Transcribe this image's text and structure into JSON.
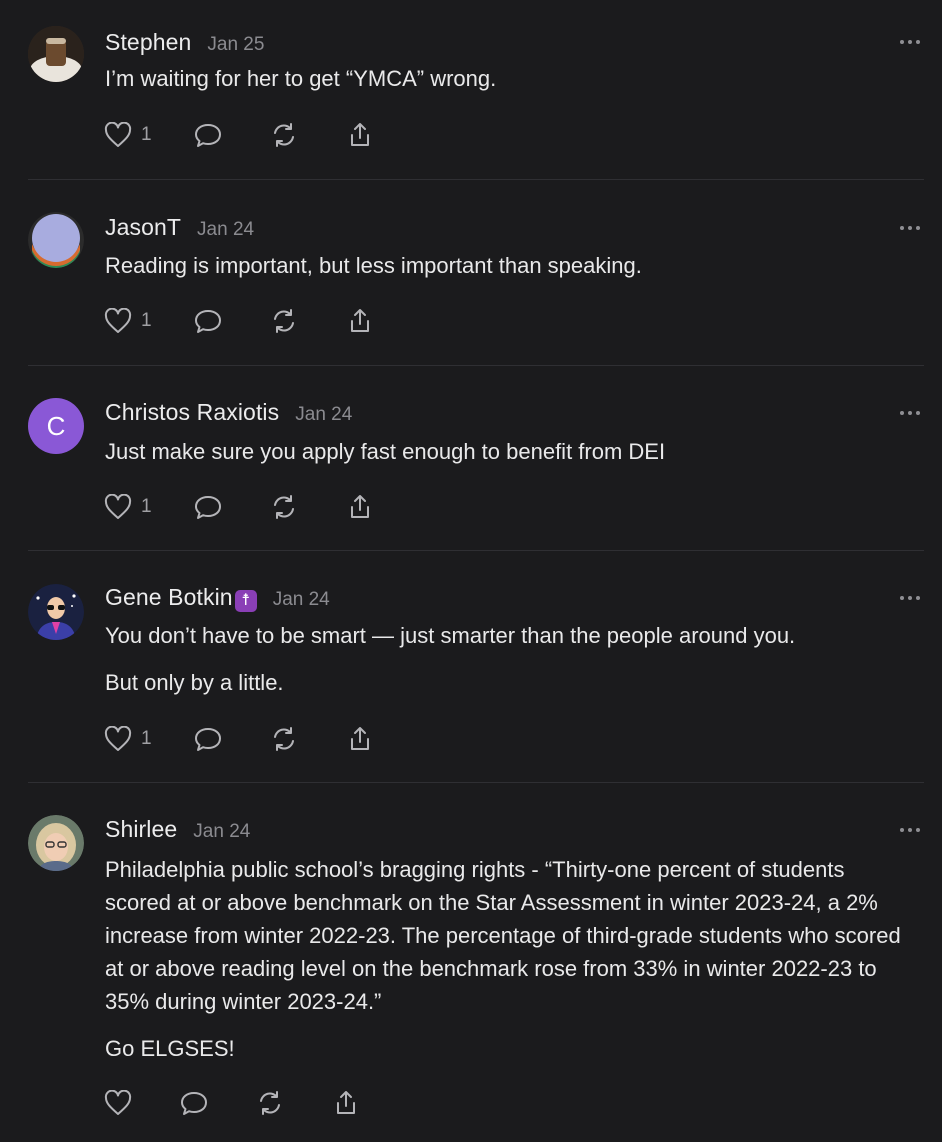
{
  "comments": [
    {
      "name": "Stephen",
      "date": "Jan 25",
      "paragraphs": [
        "I’m waiting for her to get “YMCA” wrong."
      ],
      "likes": "1"
    },
    {
      "name": "JasonT",
      "date": "Jan 24",
      "paragraphs": [
        "Reading is important, but less important than speaking."
      ],
      "likes": "1"
    },
    {
      "name": "Christos Raxiotis",
      "date": "Jan 24",
      "avatar_letter": "C",
      "avatar_color": "#8a58d6",
      "paragraphs": [
        "Just make sure you apply fast enough to benefit from DEI"
      ],
      "likes": "1"
    },
    {
      "name": "Gene Botkin",
      "badge": "☨",
      "date": "Jan 24",
      "paragraphs": [
        "You don’t have to be smart — just smarter than the people around you.",
        "But only by a little."
      ],
      "likes": "1"
    },
    {
      "name": "Shirlee",
      "date": "Jan 24",
      "paragraphs": [
        "Philadelphia public school’s bragging rights - “Thirty-one percent of students scored at or above benchmark on the Star Assessment in winter 2023-24, a 2% increase from winter 2022-23. The percentage of third-grade students who scored at or above reading level on the benchmark rose from 33% in winter 2022-23 to 35% during winter 2023-24.”",
        "Go ELGSES!"
      ],
      "likes": ""
    }
  ],
  "icons": {
    "like": "heart-icon",
    "reply": "comment-bubble-icon",
    "restack": "restack-icon",
    "share": "share-icon",
    "more": "more-dots-icon"
  },
  "colors": {
    "background": "#1b1b1d",
    "text": "#e9e9ea",
    "muted": "#8b8b90",
    "divider": "#2f2f33"
  }
}
